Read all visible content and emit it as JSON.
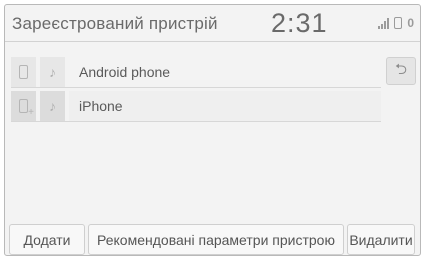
{
  "header": {
    "title": "Зареєстрований пристрій",
    "time": "2:31",
    "status_icons": [
      "signal-icon",
      "phone-icon"
    ],
    "status_value": "0"
  },
  "devices": [
    {
      "name": "Android phone",
      "icon": "phone-icon",
      "audio_icon": "music-note-icon",
      "selected": false
    },
    {
      "name": "iPhone",
      "icon": "phone-add-icon",
      "audio_icon": "music-note-icon",
      "selected": true
    }
  ],
  "back_button": {
    "icon": "back-arrow-icon",
    "glyph": "⮌"
  },
  "footer": {
    "add_label": "Додати",
    "params_label": "Рекомендовані параметри пристрою",
    "delete_label": "Видалити"
  }
}
